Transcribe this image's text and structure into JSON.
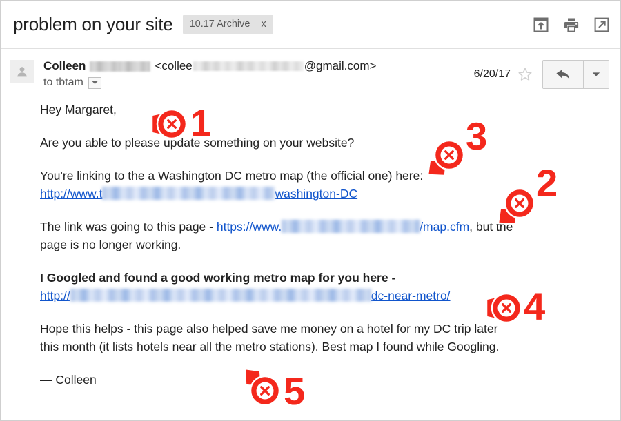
{
  "header": {
    "subject": "problem on your site",
    "label": "10.17 Archive",
    "label_remove": "x",
    "actions": [
      {
        "name": "archive-icon",
        "tooltip": "Archive"
      },
      {
        "name": "print-icon",
        "tooltip": "Print"
      },
      {
        "name": "open-in-new-window-icon",
        "tooltip": "Open in new window"
      }
    ]
  },
  "message": {
    "sender_name": "Colleen",
    "email_prefix": "<collee",
    "email_suffix": "@gmail.com>",
    "recipient": "to tbtam",
    "date": "6/20/17",
    "starred": false
  },
  "body": {
    "greeting": "Hey Margaret,",
    "paragraph_1": "Are you able to please update something on your website?",
    "paragraph_2_text": "You're linking to the a Washington DC metro map (the official one) here:",
    "link_1_prefix": "http://www.t",
    "link_1_suffix": "washington-DC",
    "paragraph_3_prefix": "The link was going to this page - ",
    "link_2_prefix": "https://www.",
    "link_2_suffix": "/map.cfm",
    "paragraph_3_suffix": ", but the",
    "paragraph_3_line2": "page is no longer working.",
    "paragraph_4_bold": "I Googled and found a good working metro map for you here -",
    "link_3_prefix": "http://",
    "link_3_suffix": "dc-near-metro/",
    "paragraph_5_line1": "Hope this helps - this page also helped save me money on a hotel for my DC trip later",
    "paragraph_5_line2": "this month (it lists hotels near all the metro stations). Best map I found while Googling.",
    "signature": "— Colleen"
  },
  "annotations": {
    "color": "#f4281c",
    "markers": [
      {
        "number": "1",
        "direction": "left"
      },
      {
        "number": "2",
        "direction": "down-left"
      },
      {
        "number": "3",
        "direction": "down-left"
      },
      {
        "number": "4",
        "direction": "left"
      },
      {
        "number": "5",
        "direction": "up-left"
      }
    ]
  },
  "colors": {
    "link": "#1155cc",
    "annotation_red": "#f4281c",
    "chip_background": "#e2e2e2",
    "text": "#222222"
  }
}
